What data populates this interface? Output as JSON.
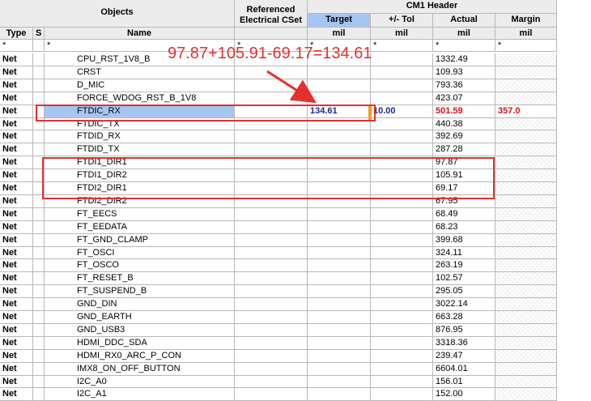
{
  "header": {
    "objects": "Objects",
    "referenced": [
      "Referenced",
      "Electrical CSet"
    ],
    "cm1": "CM1 Header",
    "target": "Target",
    "tol": "+/- Tol",
    "actual": "Actual",
    "margin": "Margin",
    "type": "Type",
    "s": "S",
    "name": "Name",
    "unit": "mil",
    "wildcard": "*"
  },
  "rows": [
    {
      "type": "Net",
      "name": "CPU_RST_1V8_B",
      "actual": "1332.49"
    },
    {
      "type": "Net",
      "name": "CRST",
      "actual": "109.93"
    },
    {
      "type": "Net",
      "name": "D_MIC",
      "actual": "793.36"
    },
    {
      "type": "Net",
      "name": "FORCE_WDOG_RST_B_1V8",
      "actual": "423.07"
    },
    {
      "type": "Net",
      "name": "FTDIC_RX",
      "actual": "501.59",
      "target": "134.61",
      "tol": "10.00",
      "margin": "357.0",
      "selected": true
    },
    {
      "type": "Net",
      "name": "FTDIC_TX",
      "actual": "440.38"
    },
    {
      "type": "Net",
      "name": "FTDID_RX",
      "actual": "392.69"
    },
    {
      "type": "Net",
      "name": "FTDID_TX",
      "actual": "287.28"
    },
    {
      "type": "Net",
      "name": "FTDI1_DIR1",
      "actual": "97.87"
    },
    {
      "type": "Net",
      "name": "FTDI1_DIR2",
      "actual": "105.91"
    },
    {
      "type": "Net",
      "name": "FTDI2_DIR1",
      "actual": "69.17"
    },
    {
      "type": "Net",
      "name": "FTDI2_DIR2",
      "actual": "67.95"
    },
    {
      "type": "Net",
      "name": "FT_EECS",
      "actual": "68.49"
    },
    {
      "type": "Net",
      "name": "FT_EEDATA",
      "actual": "68.23"
    },
    {
      "type": "Net",
      "name": "FT_GND_CLAMP",
      "actual": "399.68"
    },
    {
      "type": "Net",
      "name": "FT_OSCI",
      "actual": "324.11"
    },
    {
      "type": "Net",
      "name": "FT_OSCO",
      "actual": "263.19"
    },
    {
      "type": "Net",
      "name": "FT_RESET_B",
      "actual": "102.57"
    },
    {
      "type": "Net",
      "name": "FT_SUSPEND_B",
      "actual": "295.05"
    },
    {
      "type": "Net",
      "name": "GND_DIN",
      "actual": "3022.14"
    },
    {
      "type": "Net",
      "name": "GND_EARTH",
      "actual": "663.28"
    },
    {
      "type": "Net",
      "name": "GND_USB3",
      "actual": "876.95"
    },
    {
      "type": "Net",
      "name": "HDMI_DDC_SDA",
      "actual": "3318.36"
    },
    {
      "type": "Net",
      "name": "HDMI_RX0_ARC_P_CON",
      "actual": "239.47"
    },
    {
      "type": "Net",
      "name": "IMX8_ON_OFF_BUTTON",
      "actual": "6604.01"
    },
    {
      "type": "Net",
      "name": "I2C_A0",
      "actual": "156.01"
    },
    {
      "type": "Net",
      "name": "I2C_A1",
      "actual": "152.00"
    }
  ],
  "annotation": "97.87+105.91-69.17=134.61"
}
